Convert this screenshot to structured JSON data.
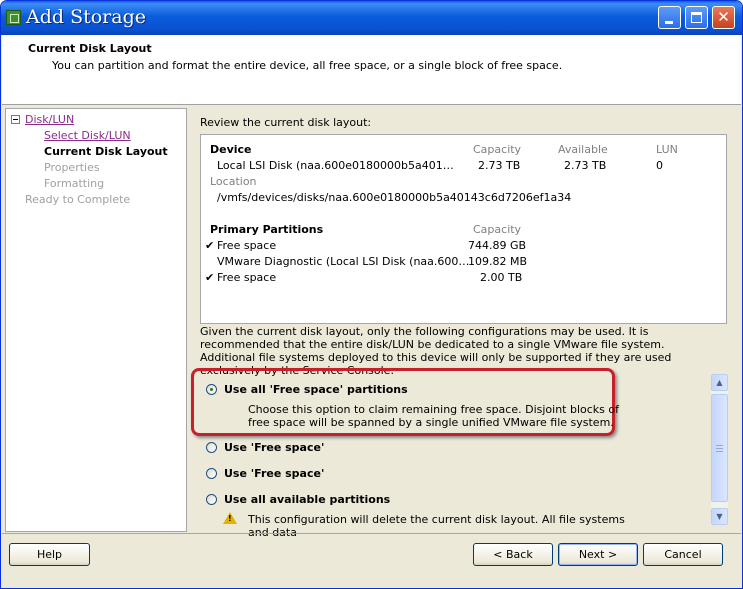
{
  "window": {
    "title": "Add Storage"
  },
  "header": {
    "title": "Current Disk Layout",
    "description": "You can partition and format the entire device, all free space, or a single block of free space."
  },
  "nav": {
    "items": [
      {
        "label": "Disk/LUN",
        "state": "link"
      },
      {
        "label": "Select Disk/LUN",
        "state": "link"
      },
      {
        "label": "Current Disk Layout",
        "state": "current"
      },
      {
        "label": "Properties",
        "state": "disabled"
      },
      {
        "label": "Formatting",
        "state": "disabled"
      },
      {
        "label": "Ready to Complete",
        "state": "disabled"
      }
    ]
  },
  "main": {
    "review_label": "Review the current disk layout:",
    "device": {
      "headers": {
        "device": "Device",
        "capacity": "Capacity",
        "available": "Available",
        "lun": "LUN"
      },
      "name": "Local LSI Disk (naa.600e0180000b5a401…",
      "capacity": "2.73 TB",
      "available": "2.73 TB",
      "lun": "0",
      "location_label": "Location",
      "location": "/vmfs/devices/disks/naa.600e0180000b5a40143c6d7206ef1a34"
    },
    "partitions": {
      "header": "Primary Partitions",
      "capacity_header": "Capacity",
      "rows": [
        {
          "checked": "✔",
          "name": "Free space",
          "capacity": "744.89 GB"
        },
        {
          "checked": "",
          "name": "VMware Diagnostic (Local LSI Disk (naa.600…",
          "capacity": "109.82 MB"
        },
        {
          "checked": "✔",
          "name": "Free space",
          "capacity": "2.00 TB"
        }
      ]
    },
    "info_text": "Given the current disk layout, only the following configurations may be used. It is recommended that the entire disk/LUN be dedicated to a single VMware file system. Additional file systems deployed to this device will only be supported if they are used exclusively by the Service Console.",
    "options": [
      {
        "label": "Use all 'Free space' partitions",
        "selected": true,
        "description": "Choose this option to claim remaining free space. Disjoint blocks of free space will be spanned by a single unified VMware file system."
      },
      {
        "label": "Use 'Free space'",
        "selected": false
      },
      {
        "label": "Use 'Free space'",
        "selected": false
      },
      {
        "label": "Use all available partitions",
        "selected": false,
        "warning": "This configuration will delete the current disk layout. All file systems and data"
      }
    ]
  },
  "buttons": {
    "help": "Help",
    "back": "< Back",
    "next": "Next >",
    "cancel": "Cancel"
  },
  "colors": {
    "titlebar": "#0b5cdb",
    "highlight_border": "#c8202a",
    "link": "#8c2b8c"
  }
}
